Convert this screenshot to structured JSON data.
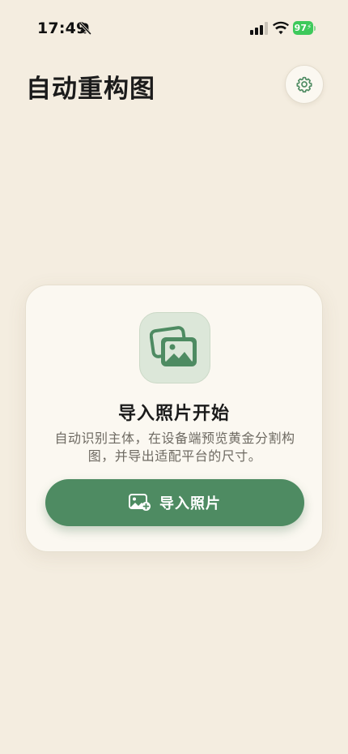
{
  "status_bar": {
    "time": "17:49",
    "battery_level": "97",
    "icons": [
      "bell-slash-icon",
      "signal-icon",
      "wifi-icon",
      "battery-icon"
    ]
  },
  "header": {
    "title": "自动重构图",
    "settings_icon": "gear-icon"
  },
  "empty_state": {
    "icon": "photos-icon",
    "title": "导入照片开始",
    "description": "自动识别主体，在设备端预览黄金分割构图，并导出适配平台的尺寸。",
    "button_label": "导入照片",
    "button_icon": "photo-add-icon"
  },
  "colors": {
    "background": "#F4EDE0",
    "card": "#FBF8F1",
    "accent": "#4E8B62",
    "icon_tile": "#DCE7D9",
    "battery": "#3DC95B"
  }
}
